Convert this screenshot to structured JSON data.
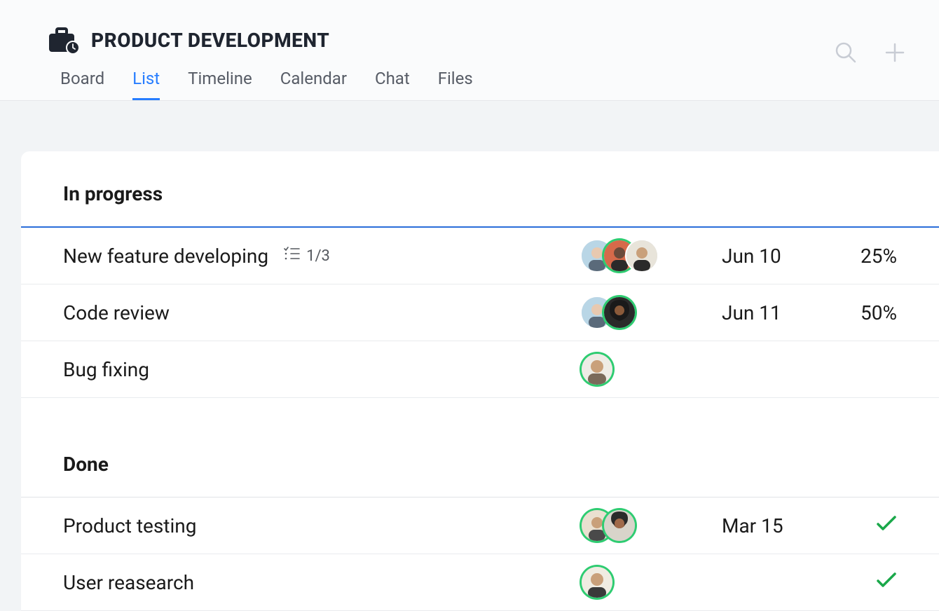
{
  "project": {
    "title": "PRODUCT DEVELOPMENT"
  },
  "tabs": {
    "board": "Board",
    "list": "List",
    "timeline": "Timeline",
    "calendar": "Calendar",
    "chat": "Chat",
    "files": "Files",
    "active": "list"
  },
  "sections": {
    "in_progress": {
      "title": "In progress",
      "rows": [
        {
          "name": "New feature developing",
          "checklist": "1/3",
          "date": "Jun 10",
          "percent": "25%",
          "assignees": 3
        },
        {
          "name": "Code review",
          "checklist": "",
          "date": "Jun 11",
          "percent": "50%",
          "assignees": 2
        },
        {
          "name": "Bug fixing",
          "checklist": "",
          "date": "",
          "percent": "",
          "assignees": 1
        }
      ]
    },
    "done": {
      "title": "Done",
      "rows": [
        {
          "name": "Product testing",
          "date": "Mar 15",
          "done": true,
          "assignees": 2
        },
        {
          "name": "User reasearch",
          "date": "",
          "done": true,
          "assignees": 1
        }
      ]
    }
  },
  "icons": {
    "briefcase": "briefcase-clock-icon",
    "search": "search-icon",
    "add": "plus-icon",
    "checklist": "checklist-icon",
    "checkmark": "checkmark-icon"
  }
}
